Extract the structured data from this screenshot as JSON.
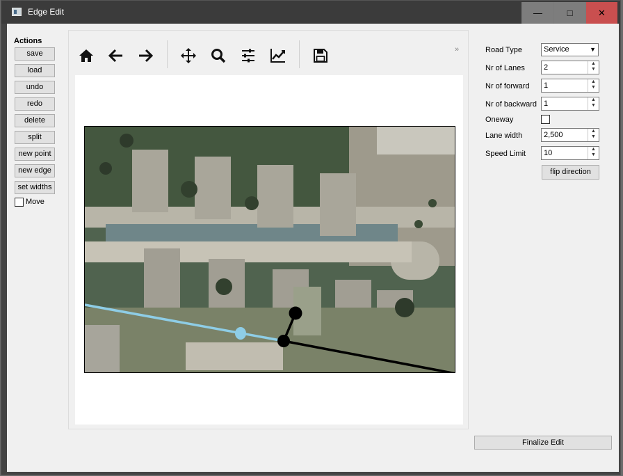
{
  "window": {
    "title": "Edge Edit",
    "minimize_glyph": "—",
    "maximize_glyph": "□",
    "close_glyph": "✕"
  },
  "actions": {
    "heading": "Actions",
    "buttons": [
      "save",
      "load",
      "undo",
      "redo",
      "delete",
      "split",
      "new point",
      "new edge",
      "set widths"
    ],
    "move_label": "Move",
    "move_checked": false
  },
  "toolbar": {
    "icons": [
      "home-icon",
      "back-arrow-icon",
      "forward-arrow-icon",
      "pan-icon",
      "zoom-icon",
      "configure-subplots-icon",
      "edit-axis-icon",
      "save-figure-icon"
    ],
    "overflow": "»"
  },
  "properties": {
    "road_type": {
      "label": "Road Type",
      "value": "Service"
    },
    "nr_lanes": {
      "label": "Nr of Lanes",
      "value": "2"
    },
    "nr_forward": {
      "label": "Nr of forward",
      "value": "1"
    },
    "nr_backward": {
      "label": "Nr of backward",
      "value": "1"
    },
    "oneway": {
      "label": "Oneway",
      "checked": false
    },
    "lane_width": {
      "label": "Lane width",
      "value": "2,500"
    },
    "speed_limit": {
      "label": "Speed Limit",
      "value": "10"
    },
    "flip_label": "flip direction"
  },
  "finalize_label": "Finalize Edit",
  "colors": {
    "selected_edge": "#8ecde6",
    "edge": "#000000",
    "close_button": "#c94f4f"
  }
}
